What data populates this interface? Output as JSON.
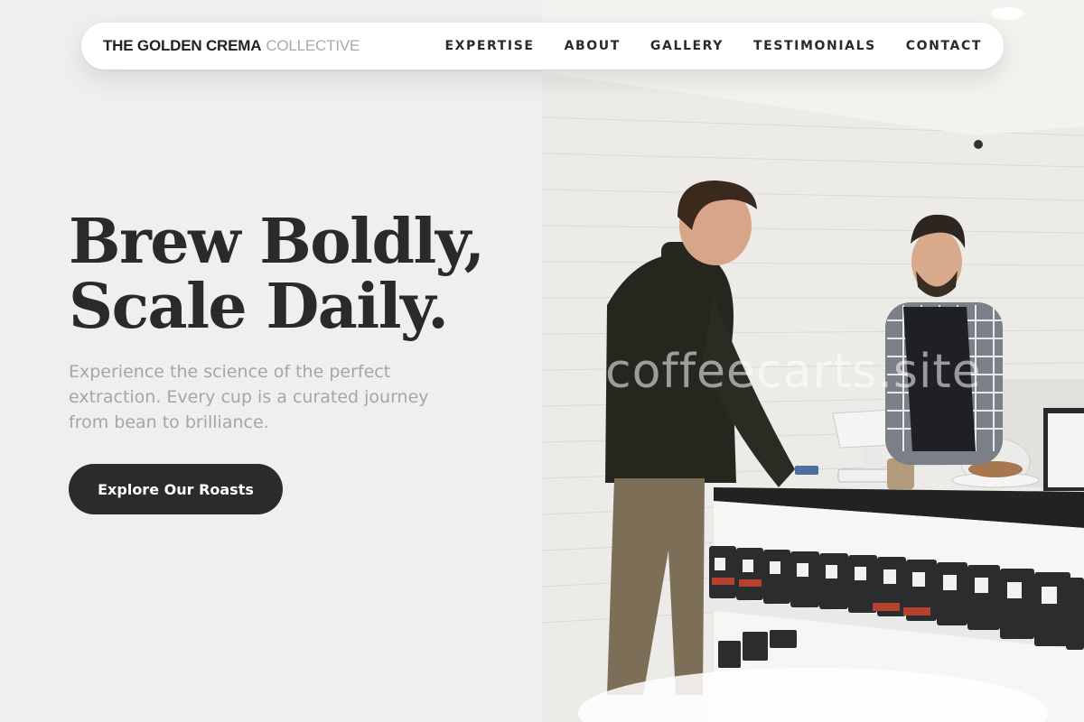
{
  "brand": {
    "main": "THE GOLDEN CREMA",
    "sub": "COLLECTIVE"
  },
  "nav": {
    "links": [
      {
        "label": "EXPERTISE"
      },
      {
        "label": "ABOUT"
      },
      {
        "label": "GALLERY"
      },
      {
        "label": "TESTIMONIALS"
      },
      {
        "label": "CONTACT"
      }
    ]
  },
  "hero": {
    "headline_line1": "Brew Boldly,",
    "headline_line2": "Scale Daily.",
    "subtext": "Experience the science of the perfect extraction. Every cup is a curated journey from bean to brilliance.",
    "cta_label": "Explore Our Roasts"
  },
  "photo": {
    "alt": "Customer paying at a coffee shop counter with a barista",
    "watermark": "coffeecarts.site"
  },
  "colors": {
    "background": "#efefef",
    "headline": "#2a2a2a",
    "subtext": "#a6a6a6",
    "cta_bg": "#2b2b2b",
    "cta_text": "#ffffff"
  }
}
